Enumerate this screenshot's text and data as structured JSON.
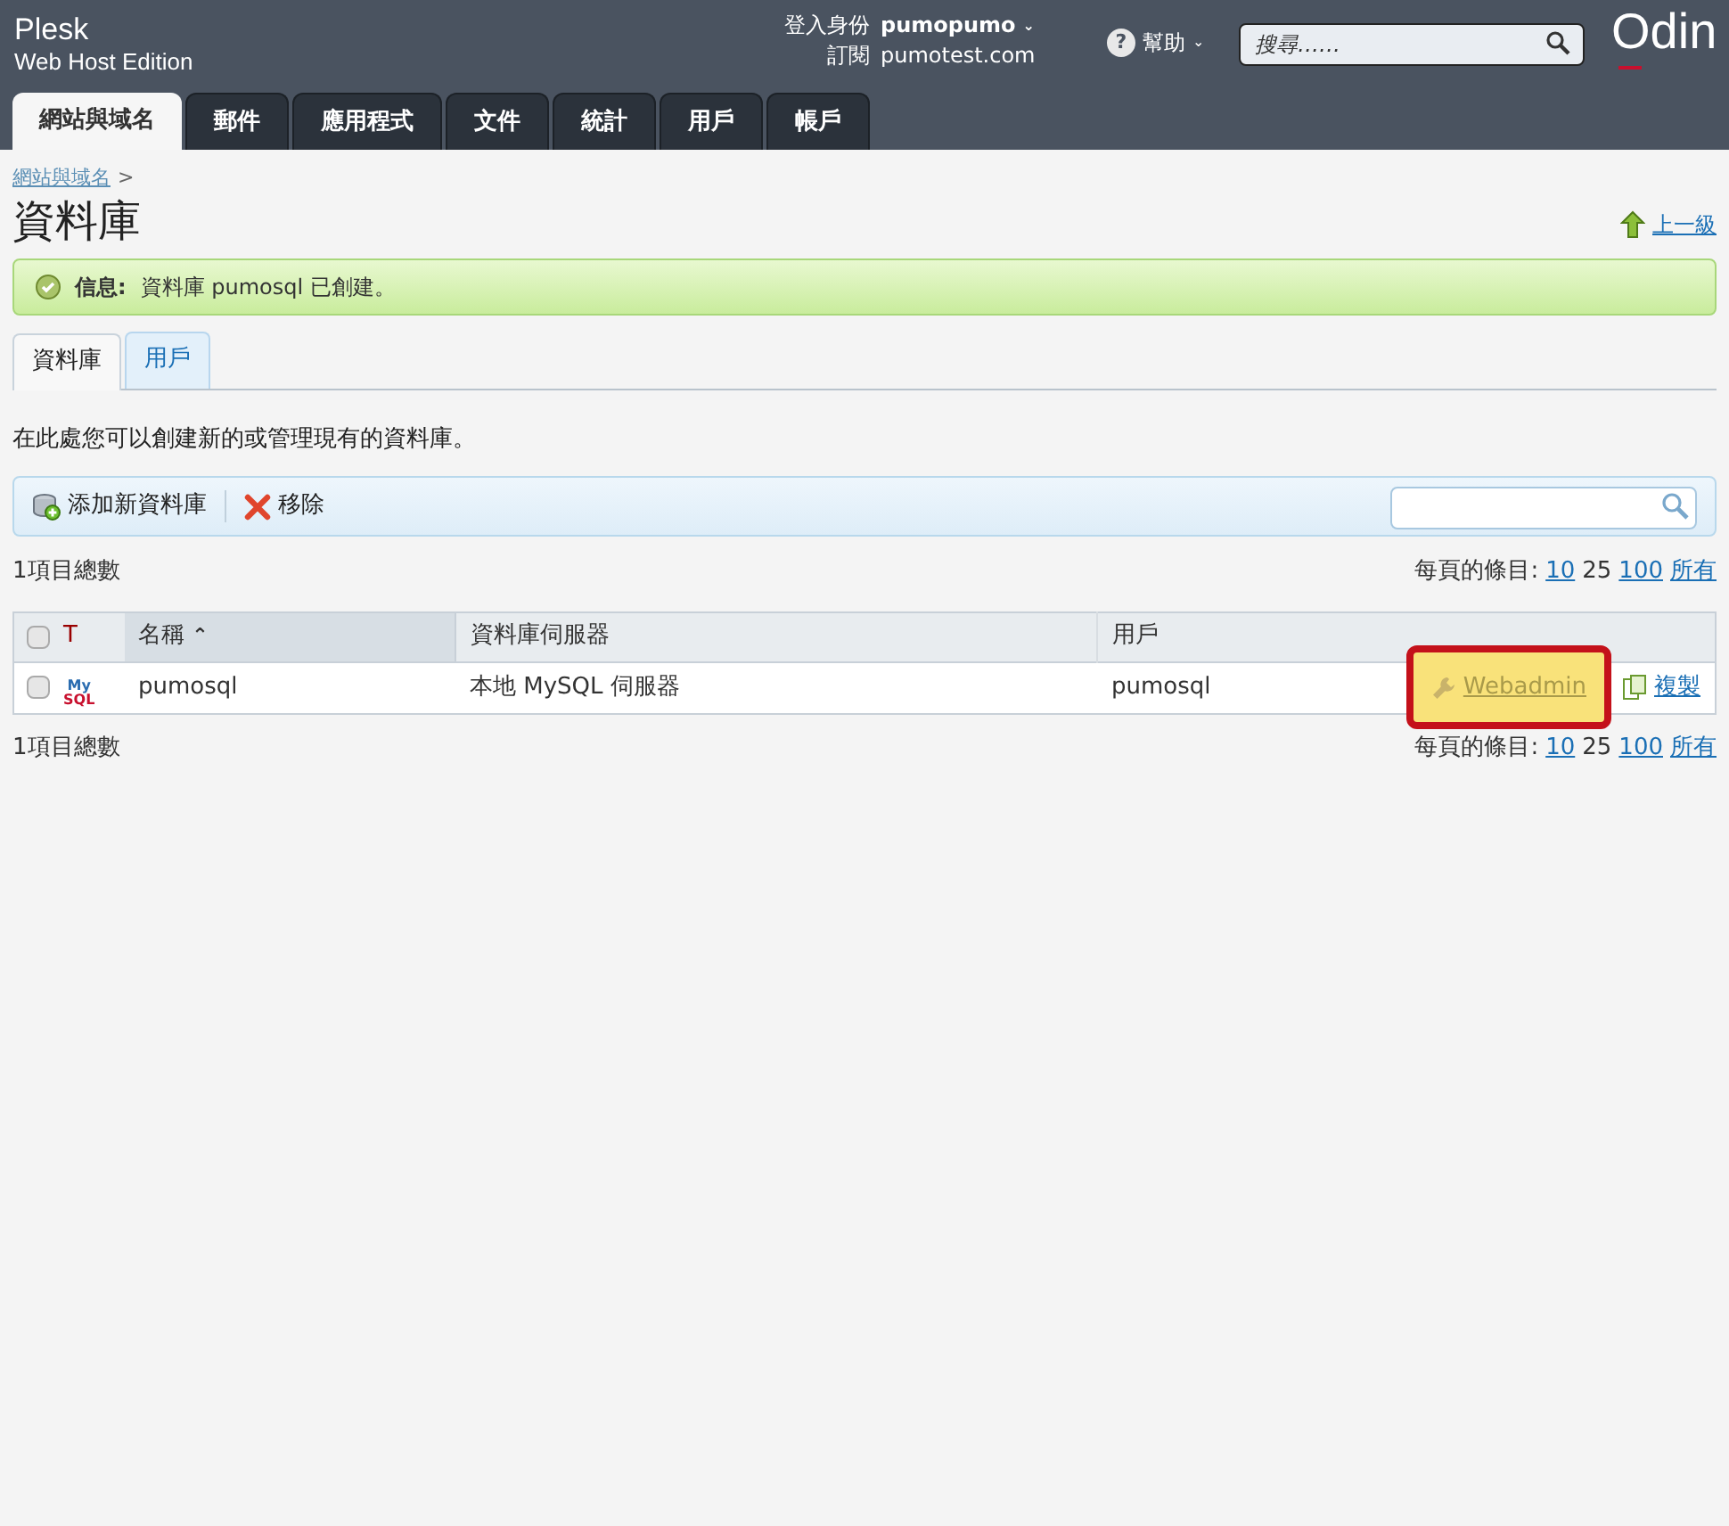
{
  "header": {
    "brand": "Plesk",
    "edition": "Web Host Edition",
    "login_label": "登入身份",
    "login_user": "pumopumo",
    "user_caret": "⌄",
    "help_mark": "?",
    "help_caret": "⌄",
    "subscription_label": "訂閱",
    "subscription": "pumotest.com",
    "help": "幫助",
    "search": {
      "placeholder": "搜尋……"
    },
    "logo": "Odin"
  },
  "main_tabs": [
    {
      "label": "網站與域名",
      "selected": true
    },
    {
      "label": "郵件",
      "selected": false
    },
    {
      "label": "應用程式",
      "selected": false
    },
    {
      "label": "文件",
      "selected": false
    },
    {
      "label": "統計",
      "selected": false
    },
    {
      "label": "用戶",
      "selected": false
    },
    {
      "label": "帳戶",
      "selected": false
    }
  ],
  "breadcrumb": {
    "link": "網站與域名",
    "separator": ">"
  },
  "page_title": "資料庫",
  "up_level": "上一級",
  "message": {
    "label": "信息:",
    "text": "資料庫 pumosql 已創建。"
  },
  "sub_tabs": [
    {
      "label": "資料庫",
      "selected": true
    },
    {
      "label": "用戶",
      "selected": false
    }
  ],
  "description": "在此處您可以創建新的或管理現有的資料庫。",
  "toolbar": [
    {
      "kind": "add",
      "label": "添加新資料庫"
    },
    {
      "kind": "remove",
      "label": "移除"
    }
  ],
  "pager_top": {
    "total": "1項目總數",
    "per_page_label": "每頁的條目:",
    "options": [
      {
        "label": "10",
        "selected": false
      },
      {
        "label": "25",
        "selected": true
      },
      {
        "label": "100",
        "selected": false
      },
      {
        "label": "所有",
        "selected": false
      }
    ]
  },
  "table": {
    "select_all_checked": false,
    "columns": [
      "T",
      "名稱",
      "資料庫伺服器",
      "用戶"
    ],
    "sorted_column_arrow": "⌃",
    "rows": [
      {
        "checked": false,
        "type_icon": {
          "top": "My",
          "bottom": "SQL"
        },
        "name": "pumosql",
        "server": "本地 MySQL 伺服器",
        "user": "pumosql",
        "actions": [
          {
            "kind": "webadmin",
            "label": "Webadmin",
            "highlighted": true
          },
          {
            "kind": "copy",
            "label": "複製",
            "highlighted": false
          }
        ]
      }
    ]
  },
  "pager_bottom": {
    "total": "1項目總數",
    "per_page_label": "每頁的條目:",
    "options": [
      {
        "label": "10",
        "selected": false
      },
      {
        "label": "25",
        "selected": true
      },
      {
        "label": "100",
        "selected": false
      },
      {
        "label": "所有",
        "selected": false
      }
    ]
  }
}
